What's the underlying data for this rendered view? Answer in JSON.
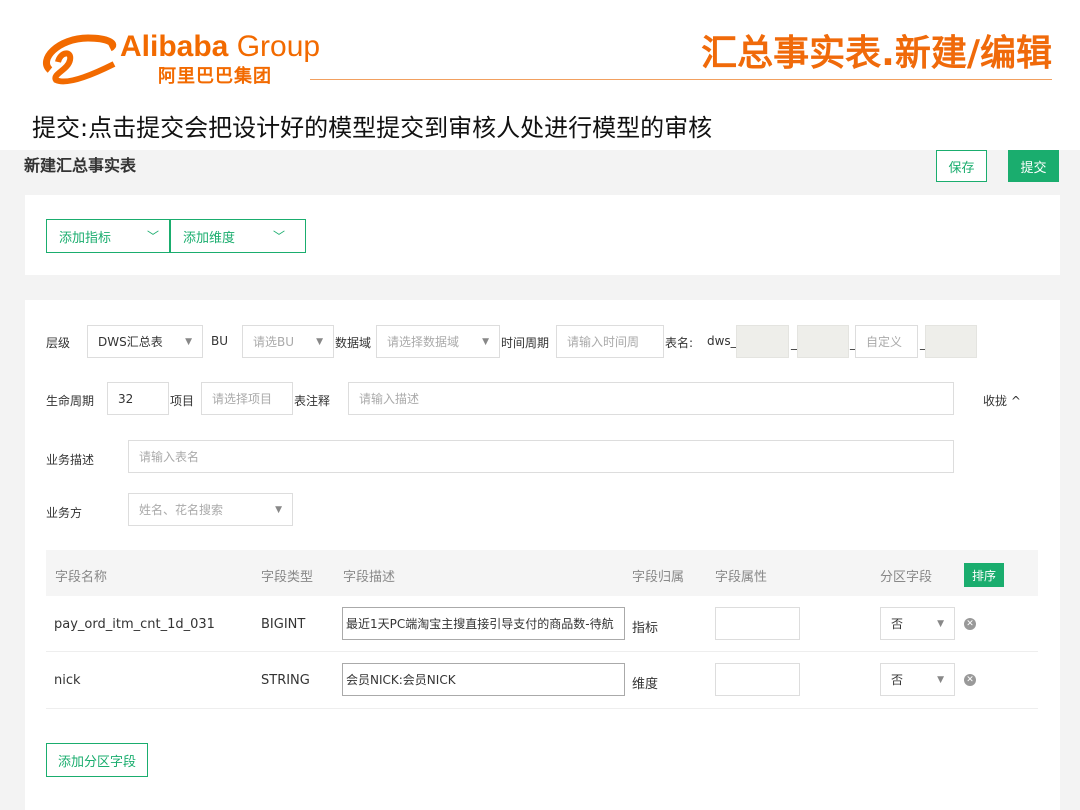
{
  "header": {
    "logo_en": "Alibaba",
    "logo_en2": " Group",
    "logo_cn": "阿里巴巴集团",
    "title": "汇总事实表.新建/编辑"
  },
  "subtitle": "提交:点击提交会把设计好的模型提交到审核人处进行模型的审核",
  "section_title": "新建汇总事实表",
  "actions": {
    "save": "保存",
    "submit": "提交"
  },
  "add": {
    "metric": "添加指标",
    "dimension": "添加维度"
  },
  "form": {
    "level_label": "层级",
    "level_value": "DWS汇总表",
    "bu_label": "BU",
    "bu_placeholder": "请选BU",
    "domain_label": "数据域",
    "domain_placeholder": "请选择数据域",
    "period_label": "时间周期",
    "period_placeholder": "请输入时间周",
    "tablename_label": "表名:",
    "tablename_prefix": "dws_",
    "sep": "_",
    "custom_placeholder": "自定义",
    "lifecycle_label": "生命周期",
    "lifecycle_value": "32",
    "project_label": "项目",
    "project_placeholder": "请选择项目",
    "comment_label": "表注释",
    "comment_placeholder": "请输入描述",
    "collapse": "收拢 ^",
    "bizdesc_label": "业务描述",
    "bizdesc_placeholder": "请输入表名",
    "bizowner_label": "业务方",
    "bizowner_placeholder": "姓名、花名搜索"
  },
  "table": {
    "headers": [
      "字段名称",
      "字段类型",
      "字段描述",
      "字段归属",
      "字段属性",
      "分区字段"
    ],
    "sort": "排序",
    "rows": [
      {
        "name": "pay_ord_itm_cnt_1d_031",
        "type": "BIGINT",
        "desc": "最近1天PC端淘宝主搜直接引导支付的商品数-待航",
        "belong": "指标",
        "attr": "",
        "partition": "否"
      },
      {
        "name": "nick",
        "type": "STRING",
        "desc": "会员NICK:会员NICK",
        "belong": "维度",
        "attr": "",
        "partition": "否"
      }
    ]
  },
  "add_partition": "添加分区字段"
}
